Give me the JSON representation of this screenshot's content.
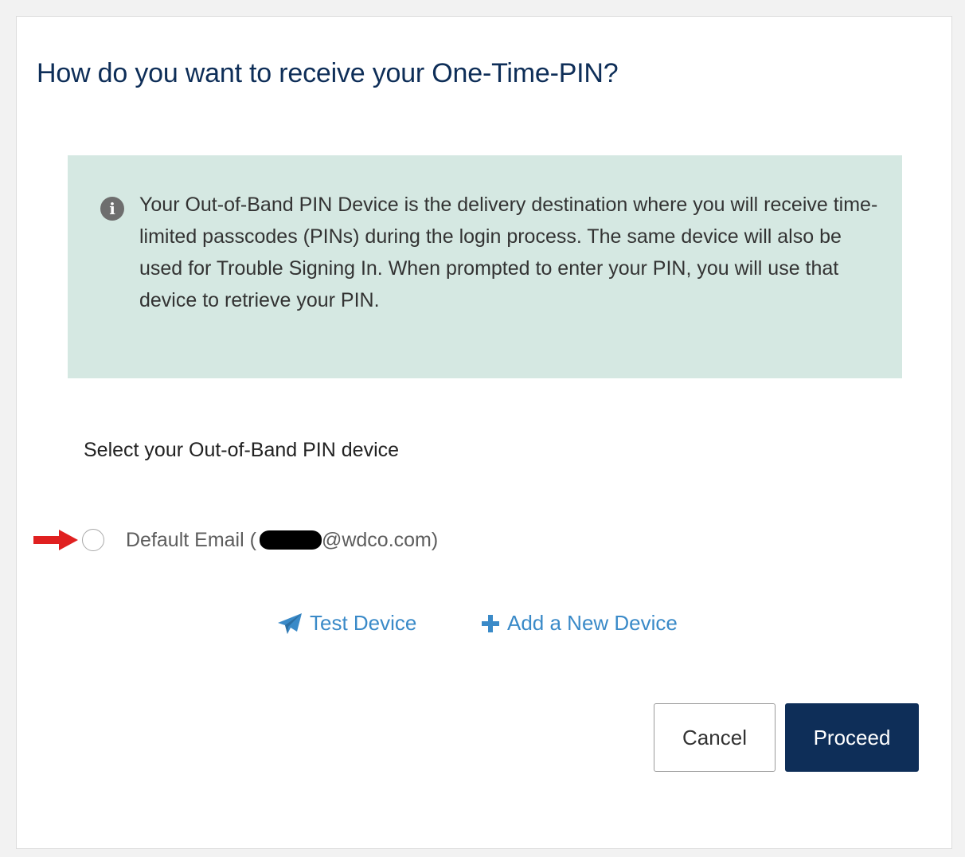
{
  "dialog": {
    "title": "How do you want to receive your One-Time-PIN?",
    "info": {
      "icon": "info-circle-icon",
      "text": "Your Out-of-Band PIN Device is the delivery destination where you will receive time-limited passcodes (PINs) during the login process. The same device will also be used for Trouble Signing In. When prompted to enter your PIN, you will use that device to retrieve your PIN."
    },
    "select_label": "Select your Out-of-Band PIN device",
    "option": {
      "label_prefix": "Default Email (",
      "label_suffix": "@wdco.com)",
      "selected": false
    },
    "links": {
      "test_device": "Test Device",
      "add_device": "Add a New Device"
    },
    "buttons": {
      "cancel": "Cancel",
      "proceed": "Proceed"
    },
    "colors": {
      "title": "#0e2e58",
      "info_bg": "#d5e8e2",
      "link": "#3a8ac8",
      "primary_button": "#0e2e58",
      "annotation_arrow": "#e02020"
    }
  }
}
